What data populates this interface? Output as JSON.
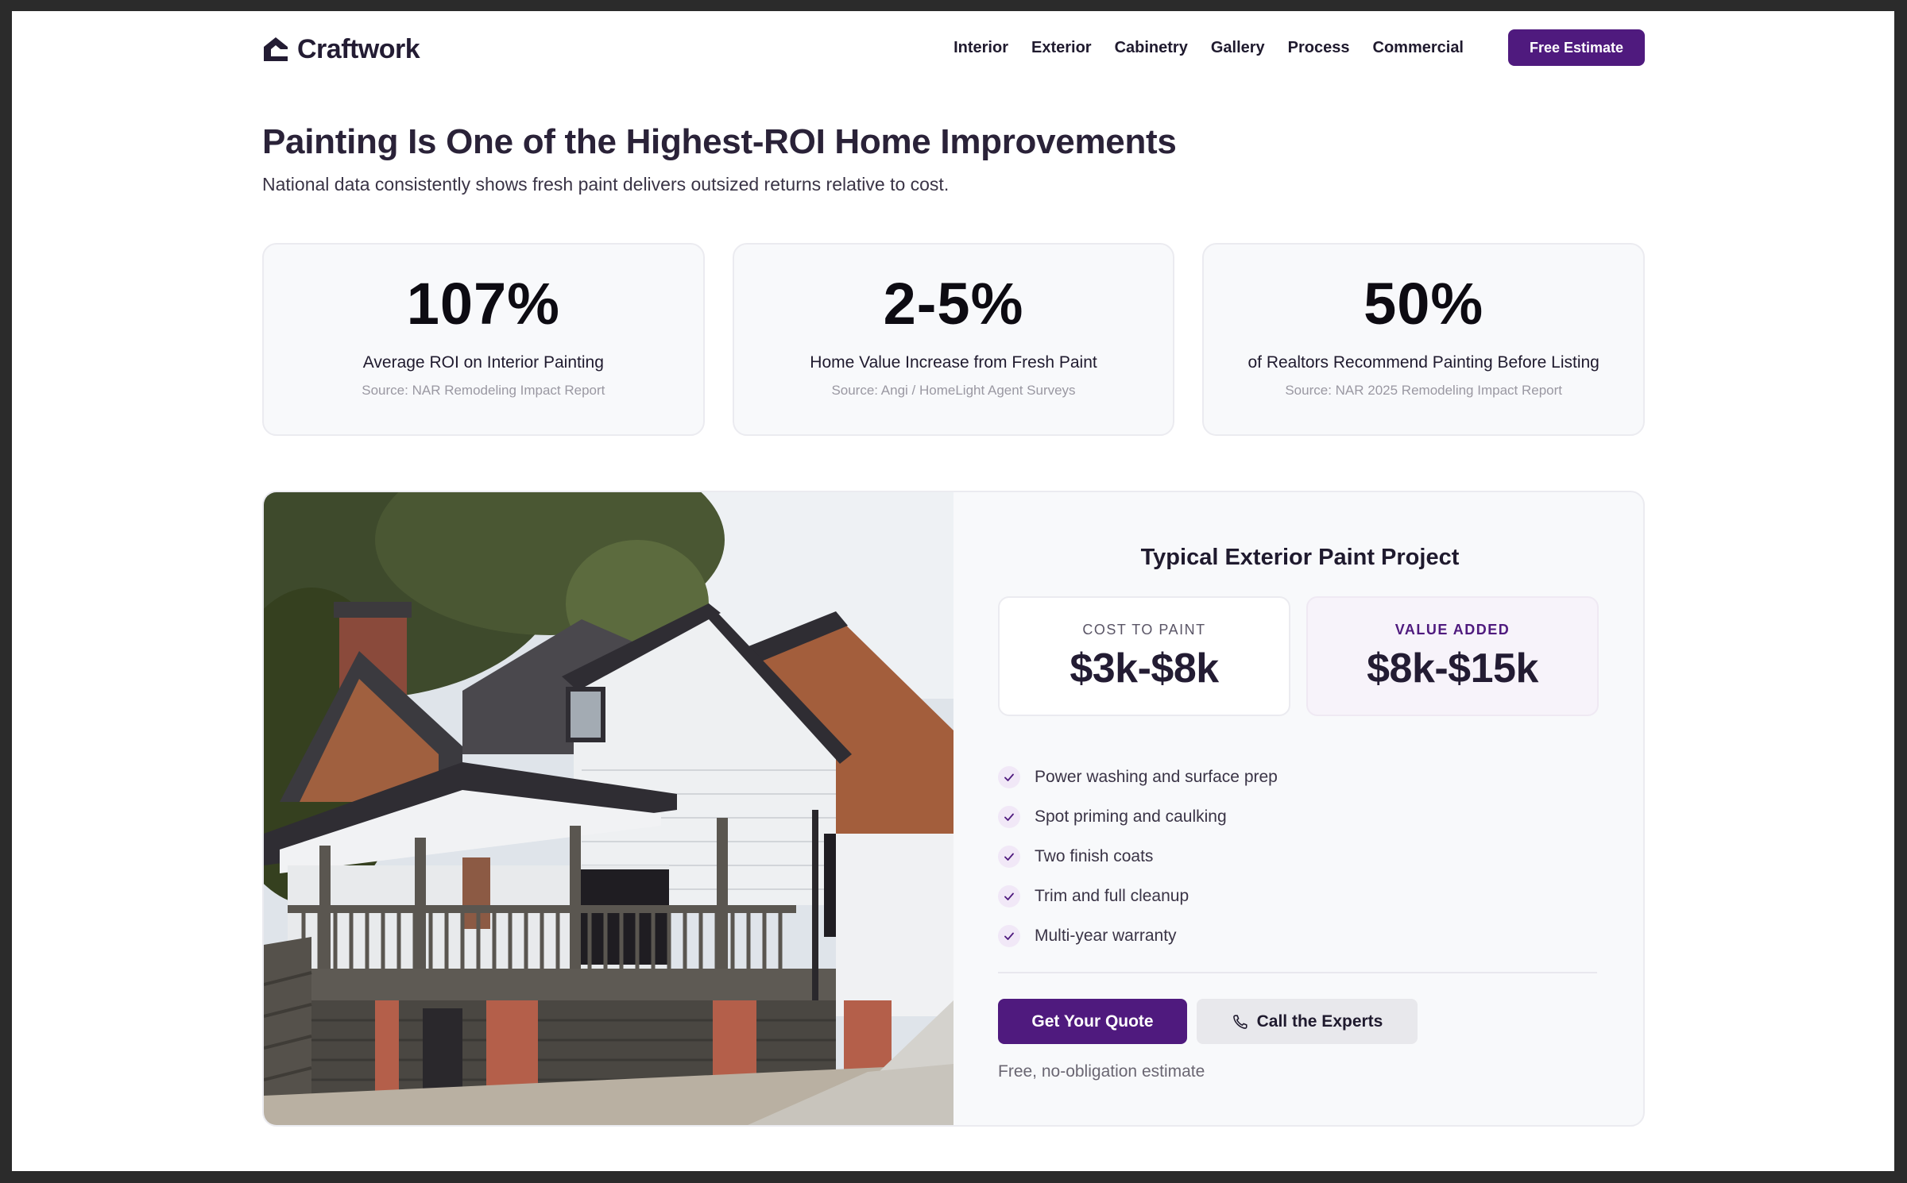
{
  "brand": {
    "name": "Craftwork"
  },
  "nav": {
    "links": [
      "Interior",
      "Exterior",
      "Cabinetry",
      "Gallery",
      "Process",
      "Commercial"
    ],
    "cta_label": "Free Estimate"
  },
  "hero": {
    "title": "Painting Is One of the Highest-ROI Home Improvements",
    "subtitle": "National data consistently shows fresh paint delivers outsized returns relative to cost."
  },
  "stats": [
    {
      "value": "107%",
      "label": "Average ROI on Interior Painting",
      "source": "Source: NAR Remodeling Impact Report"
    },
    {
      "value": "2-5%",
      "label": "Home Value Increase from Fresh Paint",
      "source": "Source: Angi / HomeLight Agent Surveys"
    },
    {
      "value": "50%",
      "label": "of Realtors Recommend Painting Before Listing",
      "source": "Source: NAR 2025 Remodeling Impact Report"
    }
  ],
  "project": {
    "title": "Typical Exterior Paint Project",
    "cost_label": "COST TO PAINT",
    "cost_value": "$3k-$8k",
    "value_label": "VALUE ADDED",
    "value_value": "$8k-$15k",
    "checklist": [
      "Power washing and surface prep",
      "Spot priming and caulking",
      "Two finish coats",
      "Trim and full cleanup",
      "Multi-year warranty"
    ],
    "primary_cta": "Get Your Quote",
    "secondary_cta": "Call the Experts",
    "note": "Free, no-obligation estimate"
  },
  "icons": {
    "logo": "house-logo-icon",
    "check": "check-icon",
    "phone": "phone-icon"
  },
  "colors": {
    "brand_purple": "#4f1a7e",
    "check_bg": "#f1e8f7",
    "card_bg": "#f8f9fb"
  }
}
